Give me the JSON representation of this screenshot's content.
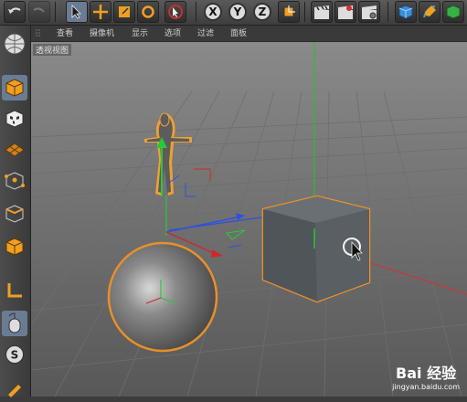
{
  "toolbar": {
    "undo_icon": "undo-icon",
    "axis_buttons": [
      "X",
      "Y",
      "Z"
    ]
  },
  "menu": [
    "查看",
    "摄像机",
    "显示",
    "选项",
    "过滤",
    "面板"
  ],
  "viewport": {
    "label": "透视视图"
  },
  "watermark": {
    "brand": "Bai 经验",
    "url": "jingyan.baidu.com"
  },
  "colors": {
    "accent_select": "#6a7c94",
    "selection_outline": "#e8902a",
    "axis_x": "#d42828",
    "axis_y": "#28b828",
    "axis_z": "#2850e0"
  }
}
